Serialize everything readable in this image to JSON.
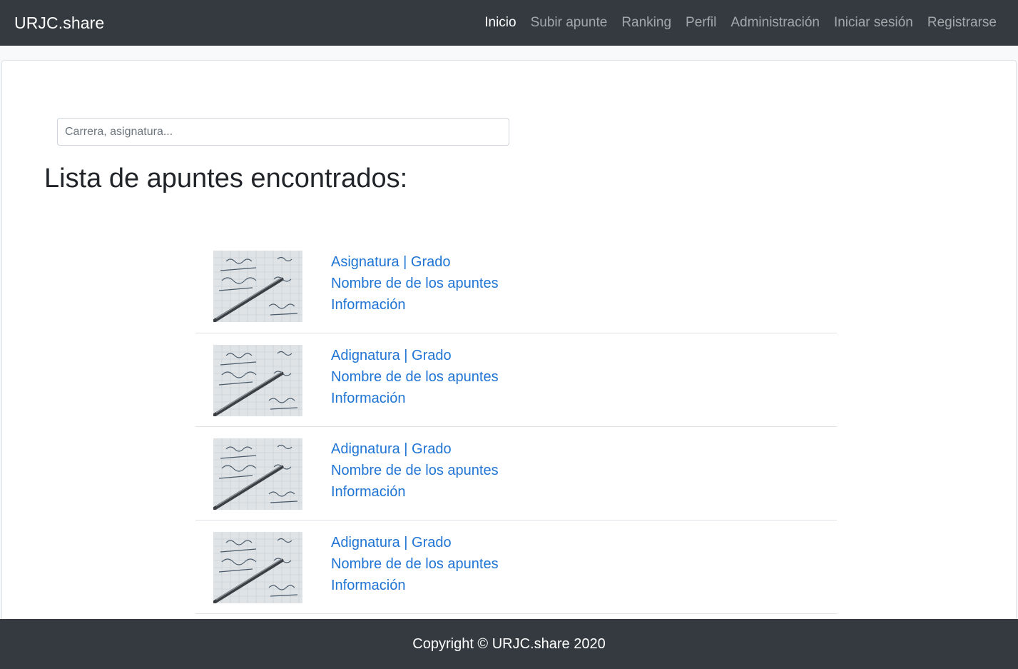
{
  "navbar": {
    "brand": "URJC.share",
    "links": [
      {
        "label": "Inicio",
        "active": true
      },
      {
        "label": "Subir apunte",
        "active": false
      },
      {
        "label": "Ranking",
        "active": false
      },
      {
        "label": "Perfil",
        "active": false
      },
      {
        "label": "Administración",
        "active": false
      },
      {
        "label": "Iniciar sesión",
        "active": false
      },
      {
        "label": "Registrarse",
        "active": false
      }
    ]
  },
  "search": {
    "placeholder": "Carrera, asignatura...",
    "value": ""
  },
  "main": {
    "title": "Lista de apuntes encontrados:",
    "notes": [
      {
        "subject": "Asignatura | Grado",
        "name": "Nombre de de los apuntes",
        "info": "Información"
      },
      {
        "subject": "Adignatura | Grado",
        "name": "Nombre de de los apuntes",
        "info": "Información"
      },
      {
        "subject": "Adignatura | Grado",
        "name": "Nombre de de los apuntes",
        "info": "Información"
      },
      {
        "subject": "Adignatura | Grado",
        "name": "Nombre de de los apuntes",
        "info": "Información"
      }
    ]
  },
  "footer": {
    "text": "Copyright © URJC.share 2020"
  },
  "colors": {
    "navbar_bg": "#343a40",
    "link": "#1f74d4",
    "card_bg": "#ffffff",
    "page_bg": "#f8f9fa"
  }
}
